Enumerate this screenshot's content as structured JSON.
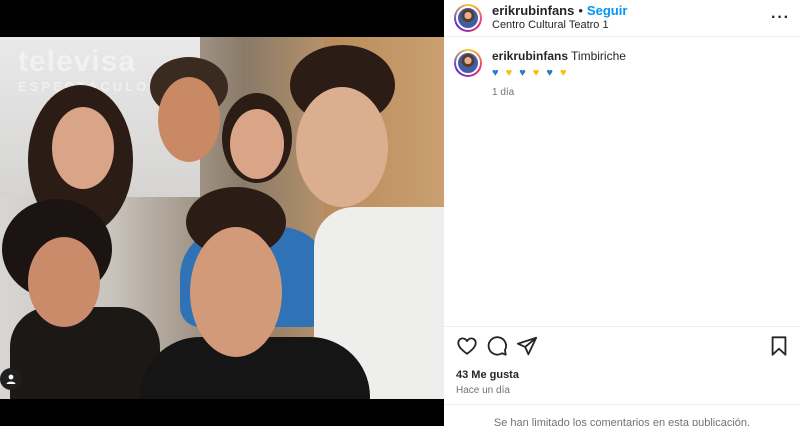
{
  "post": {
    "username": "erikrubinfans",
    "separator": "•",
    "follow_label": "Seguir",
    "location": "Centro Cultural Teatro 1",
    "more_label": "···"
  },
  "caption": {
    "username": "erikrubinfans",
    "text": "Timbiriche",
    "emoji": [
      "blue-heart",
      "yellow-heart",
      "blue-heart",
      "yellow-heart",
      "blue-heart",
      "yellow-heart"
    ],
    "time": "1 día"
  },
  "photo": {
    "watermark": "televisa",
    "watermark_sub": "ESPECTÁCULOS"
  },
  "engagement": {
    "likes": "43 Me gusta",
    "posted": "Hace un día"
  },
  "footer": {
    "comments_notice": "Se han limitado los comentarios en esta publicación."
  },
  "colors": {
    "accent": "#0095f6",
    "heart_blue": "#2a78c8",
    "heart_yellow": "#f4c20d"
  }
}
